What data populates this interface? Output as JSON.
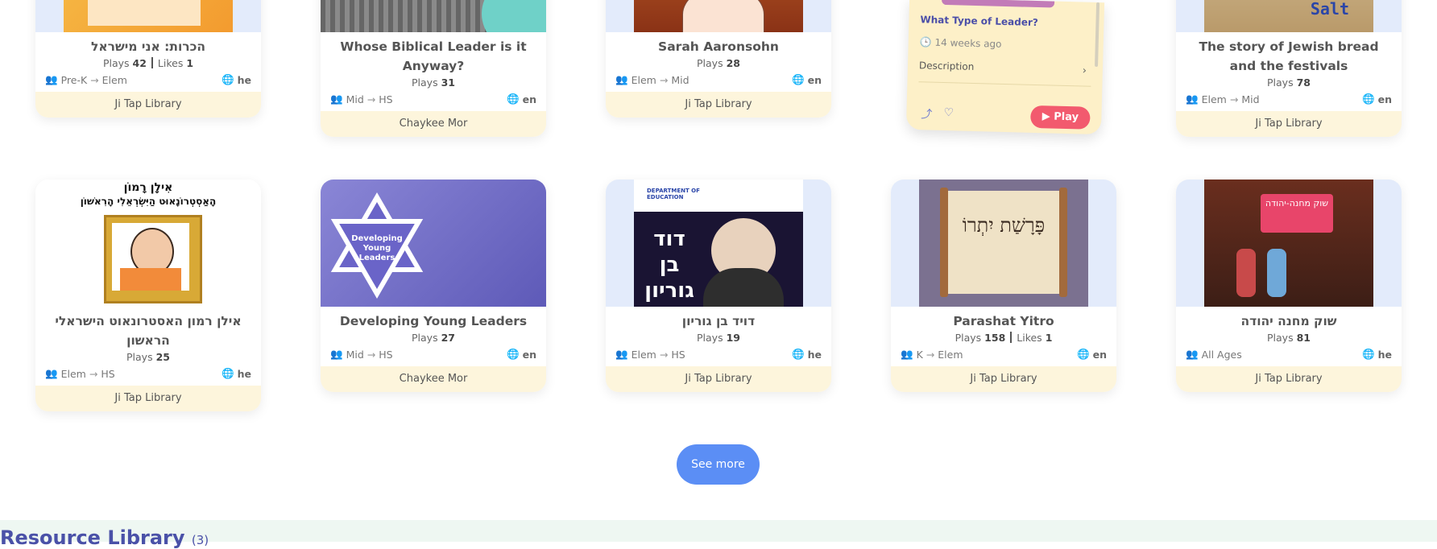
{
  "row1": [
    {
      "title": "הכרות: אני מישראל",
      "plays": "42",
      "likes": "1",
      "age_from": "Pre-K",
      "age_to": "Elem",
      "lang": "he",
      "author": "Ji Tap Library"
    },
    {
      "title": "Whose Biblical Leader is it Anyway?",
      "plays": "31",
      "likes": "",
      "age_from": "Mid",
      "age_to": "HS",
      "lang": "en",
      "author": "Chaykee Mor"
    },
    {
      "title": "Sarah Aaronsohn",
      "plays": "28",
      "likes": "",
      "age_from": "Elem",
      "age_to": "Mid",
      "lang": "en",
      "author": "Ji Tap Library"
    },
    {
      "title": "The story of Jewish bread and the festivals",
      "plays": "78",
      "likes": "",
      "age_from": "Elem",
      "age_to": "Mid",
      "lang": "en",
      "author": "Ji Tap Library",
      "thumb_text": "Salt"
    }
  ],
  "row2": [
    {
      "title": "אילן רמון האסטרונאוט הישראלי הראשון",
      "plays": "25",
      "likes": "",
      "age_from": "Elem",
      "age_to": "HS",
      "lang": "he",
      "author": "Ji Tap Library",
      "thumb_text_1": "אִילָן רָמוֹן",
      "thumb_text_2": "הָאַסְטְרוֹנָאוּט הַיִּשְׂרְאֵלִי הָרִאשׁוֹן"
    },
    {
      "title": "Developing Young Leaders",
      "plays": "27",
      "likes": "",
      "age_from": "Mid",
      "age_to": "HS",
      "lang": "en",
      "author": "Chaykee Mor",
      "thumb_text": "Developing Young Leaders"
    },
    {
      "title": "דויד בן גוריון",
      "plays": "19",
      "likes": "",
      "age_from": "Elem",
      "age_to": "HS",
      "lang": "he",
      "author": "Ji Tap Library",
      "thumb_text": "דוד בן גוריון",
      "thumb_dept": "DEPARTMENT OF EDUCATION"
    },
    {
      "title": "Parashat Yitro",
      "plays": "158",
      "likes": "1",
      "age_from": "K",
      "age_to": "Elem",
      "lang": "en",
      "author": "Ji Tap Library",
      "thumb_text": "פָּרָשַׁת יִתְרוֹ"
    },
    {
      "title": "שוק מחנה יהודה",
      "plays": "81",
      "likes": "",
      "age_all": "All Ages",
      "lang": "he",
      "author": "Ji Tap Library",
      "thumb_text": "שוק מחנה-יהודה"
    }
  ],
  "labels": {
    "plays": "Plays",
    "likes": "Likes"
  },
  "popup": {
    "question": "What Type of Leader?",
    "time": "14 weeks ago",
    "description": "Description",
    "play": "Play"
  },
  "see_more": "See more",
  "resource": {
    "title": "Resource Library",
    "count": "(3)"
  },
  "colors": {
    "accent": "#5b8ef5",
    "author_bg": "#fdf5dc",
    "play": "#f25a6e",
    "resource_title": "#4a51a8"
  }
}
